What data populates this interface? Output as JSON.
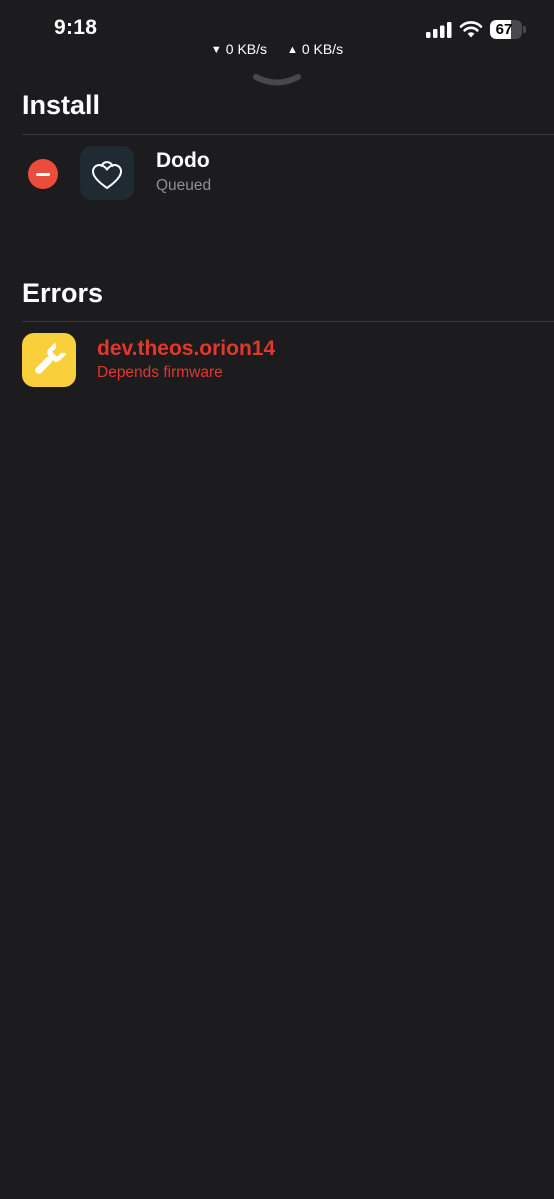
{
  "status_bar": {
    "time": "9:18",
    "download_speed": "0 KB/s",
    "upload_speed": "0 KB/s",
    "battery_level": "67",
    "battery_fraction": 0.67,
    "icons": [
      "signal-icon",
      "wifi-icon",
      "battery-icon"
    ]
  },
  "sheet": {
    "grabber_icon": "chevron-down-icon"
  },
  "install": {
    "title": "Install",
    "items": [
      {
        "name": "Dodo",
        "status": "Queued",
        "icon": "heart-lock-icon",
        "action_icon": "remove-icon"
      }
    ]
  },
  "errors": {
    "title": "Errors",
    "items": [
      {
        "name": "dev.theos.orion14",
        "message": "Depends firmware",
        "icon": "wrench-icon"
      }
    ]
  },
  "colors": {
    "background": "#1c1c1e",
    "error_text": "#e2372b",
    "remove_red": "#eb4d3d",
    "secondary_text": "#8e8e93",
    "divider": "#3a3a3c",
    "dodo_icon_bg": "#1f2a33",
    "wrench_icon_bg": "#f9cf3b"
  }
}
